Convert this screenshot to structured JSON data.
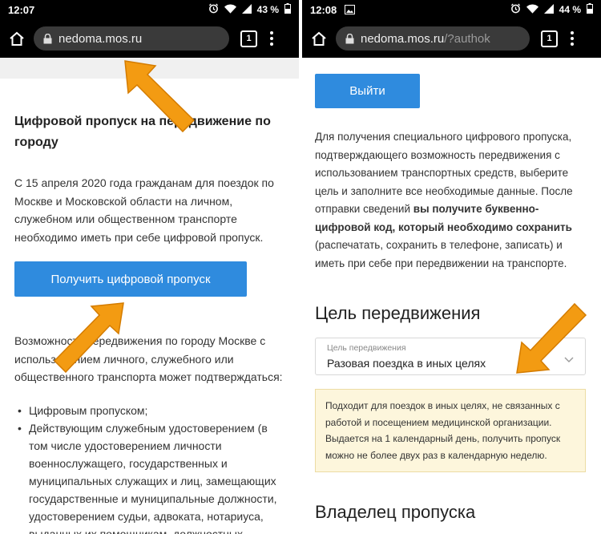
{
  "left": {
    "status": {
      "time": "12:07",
      "battery_pct": "43 %"
    },
    "url": {
      "host": "nedoma.mos.ru",
      "path": ""
    },
    "tabs_count": "1",
    "title": "Цифровой пропуск на передвижение по городу",
    "intro": "С 15 апреля 2020 года гражданам для поездок по Москве и Московской области на личном, служебном или общественном транспорте необходимо иметь при себе цифровой пропуск.",
    "get_pass_button": "Получить цифровой пропуск",
    "confirm_text": "Возможность передвижения по городу Москве с использованием личного, служебного или общественного транспорта может подтверждаться:",
    "list": [
      "Цифровым пропуском;",
      "Действующим служебным удостоверением (в том числе удостоверением личности военнослужащего, государственных и муниципальных служащих и лиц, замещающих государственные и муниципальные должности, удостоверением судьи, адвоката, нотариуса, выданных их помощникам, должностных"
    ]
  },
  "right": {
    "status": {
      "time": "12:08",
      "battery_pct": "44 %"
    },
    "url": {
      "host": "nedoma.mos.ru",
      "path": "/?authok"
    },
    "tabs_count": "1",
    "logout_button": "Выйти",
    "info_part1": "Для получения специального цифрового пропуска, подтверждающего возможность передвижения с использованием транспортных средств, выберите цель и заполните все необходимые данные. После отправки сведений",
    "info_bold": "вы получите буквенно-цифровой код, который необходимо сохранить",
    "info_part2": "(распечатать, сохранить в телефоне, записать) и иметь при себе при передвижении на транспорте.",
    "purpose_heading": "Цель передвижения",
    "purpose_select": {
      "label": "Цель передвижения",
      "value": "Разовая поездка в иных целях"
    },
    "purpose_note": "Подходит для поездок в иных целях, не связанных с работой и посещением медицинской организации. Выдается на 1 календарный день, получить пропуск можно не более двух раз в календарную неделю.",
    "owner_heading": "Владелец пропуска"
  },
  "colors": {
    "accent": "#2f8bde",
    "arrow": "#f39b12",
    "note_bg": "#fdf6dc"
  },
  "icons": [
    "alarm-icon",
    "wifi-icon",
    "signal-icon",
    "battery-icon",
    "image-icon",
    "home-icon",
    "lock-icon",
    "tab-switcher-icon",
    "more-menu-icon",
    "chevron-down-icon",
    "arrow-pointer"
  ]
}
